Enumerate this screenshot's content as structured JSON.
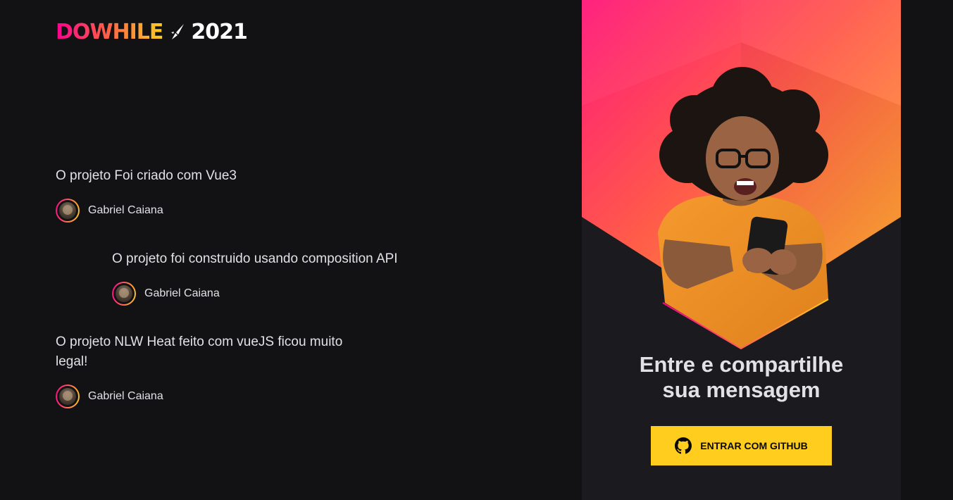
{
  "logo": {
    "brand": "DOWHILE",
    "year": "2021"
  },
  "messages": [
    {
      "content": "O projeto Foi criado com Vue3",
      "user": {
        "name": "Gabriel Caiana"
      }
    },
    {
      "content": "O projeto foi construido usando composition API",
      "user": {
        "name": "Gabriel Caiana"
      }
    },
    {
      "content": "O projeto NLW Heat feito com vueJS ficou muito legal!",
      "user": {
        "name": "Gabriel Caiana"
      }
    }
  ],
  "login": {
    "title": "Entre e compartilhe sua mensagem",
    "button_label": "Entrar com github"
  },
  "icons": {
    "logo_rocket": "rocket-icon",
    "github": "github-icon",
    "avatar": "avatar-image"
  },
  "colors": {
    "background": "#121214",
    "panel": "#1b1b1f",
    "accent_pink": "#ff008e",
    "accent_orange": "#ff5a4a",
    "accent_yellow": "#ffcd1e",
    "text": "#e1e1e6"
  }
}
